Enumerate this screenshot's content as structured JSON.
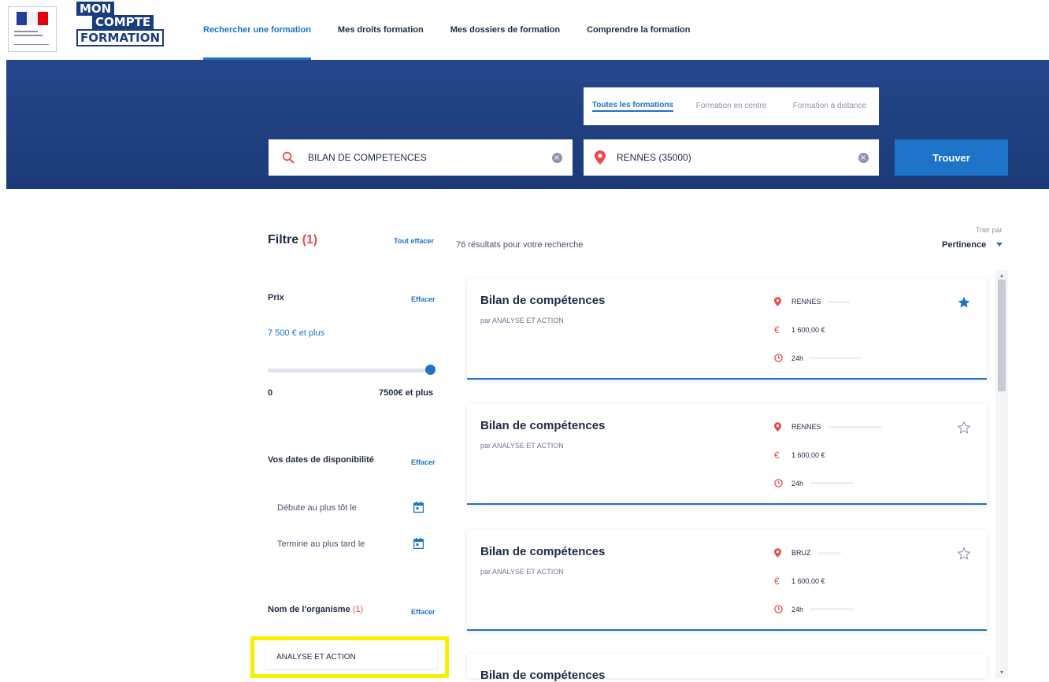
{
  "header": {
    "brand_lines": [
      "MON",
      "COMPTE",
      "FORMATION"
    ],
    "nav": [
      {
        "label": "Rechercher une formation",
        "active": true
      },
      {
        "label": "Mes droits formation",
        "active": false
      },
      {
        "label": "Mes dossiers de formation",
        "active": false
      },
      {
        "label": "Comprendre la formation",
        "active": false
      }
    ]
  },
  "search": {
    "modes": [
      {
        "label": "Toutes les formations",
        "active": true
      },
      {
        "label": "Formation en centre",
        "active": false
      },
      {
        "label": "Formation à distance",
        "active": false
      }
    ],
    "what": {
      "value": "BILAN DE COMPETENCES",
      "icon": "search-icon"
    },
    "where": {
      "value": "RENNES (35000)",
      "icon": "location-pin-icon"
    },
    "submit_label": "Trouver"
  },
  "filters": {
    "title": "Filtre",
    "count": "(1)",
    "clear_all": "Tout effacer",
    "price": {
      "label": "Prix",
      "clear": "Effacer",
      "value": "7 500 € et plus",
      "slider_fraction": 1.0,
      "min_label": "0",
      "max_label": "7500€ et plus"
    },
    "dates": {
      "label": "Vos dates de disponibilité",
      "clear": "Effacer",
      "start": "Débute au plus tôt le",
      "end": "Termine au plus tard le"
    },
    "organisme": {
      "label": "Nom de l'organisme",
      "count": "(1)",
      "clear": "Effacer",
      "selected": "ANALYSE ET ACTION"
    }
  },
  "results": {
    "summary": "76 résultats pour votre recherche",
    "sort_label": "Trier par",
    "sort_value": "Pertinence",
    "cards": [
      {
        "title": "Bilan de compétences",
        "org": "par ANALYSE ET ACTION",
        "city": "RENNES",
        "price": "1 600,00 €",
        "duration": "24h",
        "favorite": true
      },
      {
        "title": "Bilan de compétences",
        "org": "par ANALYSE ET ACTION",
        "city": "RENNES",
        "price": "1 600,00 €",
        "duration": "24h",
        "favorite": false
      },
      {
        "title": "Bilan de compétences",
        "org": "par ANALYSE ET ACTION",
        "city": "BRUZ",
        "price": "1 600,00 €",
        "duration": "24h",
        "favorite": false
      }
    ],
    "peek_title": "Bilan de compétences"
  },
  "colors": {
    "accent": "#1c73c8",
    "band": "#1b3a78",
    "brand": "#1a3e7d",
    "alert": "#e84b4b",
    "highlight": "#f6f000"
  }
}
